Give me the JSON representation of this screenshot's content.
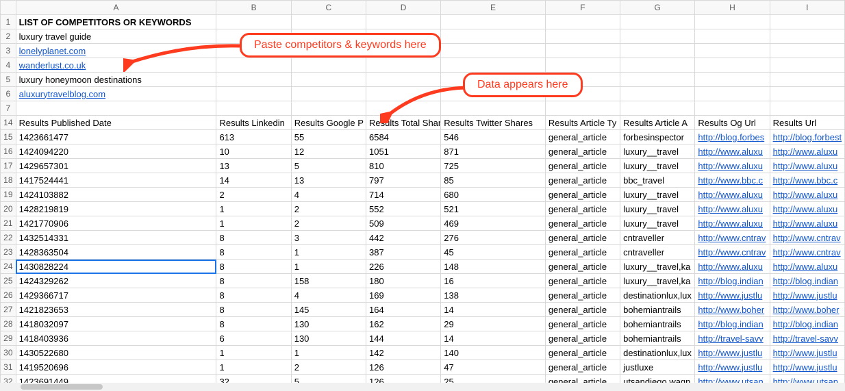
{
  "columns": [
    "A",
    "B",
    "C",
    "D",
    "E",
    "F",
    "G",
    "H",
    "I"
  ],
  "row_numbers_top": [
    1,
    2,
    3,
    4,
    5,
    6,
    7
  ],
  "row_numbers_data": [
    14,
    15,
    16,
    17,
    18,
    19,
    20,
    21,
    22,
    23,
    24,
    25,
    26,
    27,
    28,
    29,
    30,
    31,
    32
  ],
  "header_title": "LIST OF COMPETITORS OR KEYWORDS",
  "keywords": [
    {
      "text": "luxury travel guide",
      "link": false
    },
    {
      "text": "lonelyplanet.com",
      "link": true
    },
    {
      "text": "wanderlust.co.uk",
      "link": true
    },
    {
      "text": "luxury honeymoon destinations",
      "link": false
    },
    {
      "text": "aluxurytravelblog.com",
      "link": true
    }
  ],
  "data_headers": {
    "A": "Results Published Date",
    "B": "Results Linkedin",
    "C": "Results Google P",
    "D": "Results Total Shares With",
    "E": "Results Twitter Shares",
    "F": "Results Article Ty",
    "G": "Results Article A",
    "H": "Results Og Url",
    "I": "Results Url"
  },
  "rows": [
    {
      "A": "1423661477",
      "B": "613",
      "C": "55",
      "D": "6584",
      "E": "546",
      "F": "general_article",
      "G": "forbesinspector",
      "H": "http://blog.forbes",
      "I": "http://blog.forbest"
    },
    {
      "A": "1424094220",
      "B": "10",
      "C": "12",
      "D": "1051",
      "E": "871",
      "F": "general_article",
      "G": "luxury__travel",
      "H": "http://www.aluxu",
      "I": "http://www.aluxu"
    },
    {
      "A": "1429657301",
      "B": "13",
      "C": "5",
      "D": "810",
      "E": "725",
      "F": "general_article",
      "G": "luxury__travel",
      "H": "http://www.aluxu",
      "I": "http://www.aluxu"
    },
    {
      "A": "1417524441",
      "B": "14",
      "C": "13",
      "D": "797",
      "E": "85",
      "F": "general_article",
      "G": "bbc_travel",
      "H": "http://www.bbc.c",
      "I": "http://www.bbc.c"
    },
    {
      "A": "1424103882",
      "B": "2",
      "C": "4",
      "D": "714",
      "E": "680",
      "F": "general_article",
      "G": "luxury__travel",
      "H": "http://www.aluxu",
      "I": "http://www.aluxu"
    },
    {
      "A": "1428219819",
      "B": "1",
      "C": "2",
      "D": "552",
      "E": "521",
      "F": "general_article",
      "G": "luxury__travel",
      "H": "http://www.aluxu",
      "I": "http://www.aluxu"
    },
    {
      "A": "1421770906",
      "B": "1",
      "C": "2",
      "D": "509",
      "E": "469",
      "F": "general_article",
      "G": "luxury__travel",
      "H": "http://www.aluxu",
      "I": "http://www.aluxu"
    },
    {
      "A": "1432514331",
      "B": "8",
      "C": "3",
      "D": "442",
      "E": "276",
      "F": "general_article",
      "G": "cntraveller",
      "H": "http://www.cntrav",
      "I": "http://www.cntrav"
    },
    {
      "A": "1428363504",
      "B": "8",
      "C": "1",
      "D": "387",
      "E": "45",
      "F": "general_article",
      "G": "cntraveller",
      "H": "http://www.cntrav",
      "I": "http://www.cntrav"
    },
    {
      "A": "1430828224",
      "B": "8",
      "C": "1",
      "D": "226",
      "E": "148",
      "F": "general_article",
      "G": "luxury__travel,ka",
      "H": "http://www.aluxu",
      "I": "http://www.aluxu"
    },
    {
      "A": "1424329262",
      "B": "8",
      "C": "158",
      "D": "180",
      "E": "16",
      "F": "general_article",
      "G": "luxury__travel,ka",
      "H": "http://blog.indian",
      "I": "http://blog.indian"
    },
    {
      "A": "1429366717",
      "B": "8",
      "C": "4",
      "D": "169",
      "E": "138",
      "F": "general_article",
      "G": "destinationlux,lux",
      "H": "http://www.justlu",
      "I": "http://www.justlu"
    },
    {
      "A": "1421823653",
      "B": "8",
      "C": "145",
      "D": "164",
      "E": "14",
      "F": "general_article",
      "G": "bohemiantrails",
      "H": "http://www.boher",
      "I": "http://www.boher"
    },
    {
      "A": "1418032097",
      "B": "8",
      "C": "130",
      "D": "162",
      "E": "29",
      "F": "general_article",
      "G": "bohemiantrails",
      "H": "http://blog.indian",
      "I": "http://blog.indian"
    },
    {
      "A": "1418403936",
      "B": "6",
      "C": "130",
      "D": "144",
      "E": "14",
      "F": "general_article",
      "G": "bohemiantrails",
      "H": "http://travel-savv",
      "I": "http://travel-savv"
    },
    {
      "A": "1430522680",
      "B": "1",
      "C": "1",
      "D": "142",
      "E": "140",
      "F": "general_article",
      "G": "destinationlux,lux",
      "H": "http://www.justlu",
      "I": "http://www.justlu"
    },
    {
      "A": "1419520696",
      "B": "1",
      "C": "2",
      "D": "126",
      "E": "47",
      "F": "general_article",
      "G": "justluxe",
      "H": "http://www.justlu",
      "I": "http://www.justlu"
    },
    {
      "A": "1423691449",
      "B": "32",
      "C": "5",
      "D": "126",
      "E": "25",
      "F": "general_article",
      "G": "utsandiego,wagn",
      "H": "http://www.utsan",
      "I": "http://www.utsan"
    }
  ],
  "selected_row_index": 9,
  "callouts": {
    "paste": "Paste competitors & keywords here",
    "data": "Data appears here"
  }
}
